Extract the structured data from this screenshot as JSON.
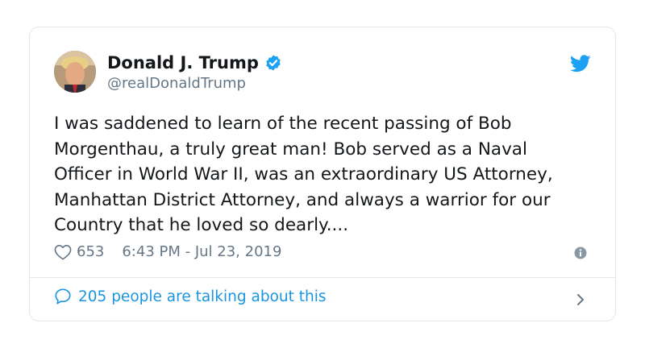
{
  "tweet": {
    "author_name": "Donald J. Trump",
    "handle": "@realDonaldTrump",
    "text": "I was saddened to learn of the recent passing of Bob Morgenthau, a truly great man! Bob served as a Naval Officer in World War II, was an extraordinary US Attorney, Manhattan District Attorney, and always a warrior for our Country that he loved so dearly....",
    "likes": "653",
    "timestamp": "6:43 PM - Jul 23, 2019",
    "conversation_label": "205 people are talking about this"
  },
  "icons": {
    "verified": "verified-badge-icon",
    "brand": "twitter-bird-icon",
    "like": "heart-icon",
    "info": "info-icon",
    "reply": "speech-bubble-icon",
    "more": "chevron-right-icon"
  },
  "colors": {
    "brand": "#1da1f2",
    "link": "#1b95e0",
    "secondary_text": "#657786",
    "border": "#e1e8ed"
  }
}
